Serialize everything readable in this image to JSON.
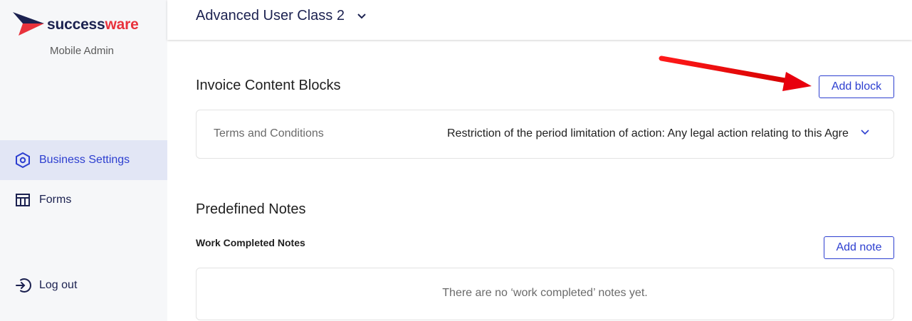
{
  "brand": {
    "name_part1": "success",
    "name_part2": "ware",
    "subtitle": "Mobile Admin",
    "colors": {
      "navy": "#1b2150",
      "red": "#e8323c",
      "blue": "#2d3fd0"
    }
  },
  "sidebar": {
    "items": [
      {
        "label": "Business Settings",
        "icon": "hexagon-settings-icon",
        "active": true
      },
      {
        "label": "Forms",
        "icon": "table-icon",
        "active": false
      }
    ],
    "logout": {
      "label": "Log out",
      "icon": "logout-icon"
    }
  },
  "header": {
    "title": "Advanced User Class 2",
    "icon": "chevron-down-icon"
  },
  "invoice": {
    "title": "Invoice Content Blocks",
    "add_button": "Add block",
    "blocks": [
      {
        "label": "Terms and Conditions",
        "value": "Restriction of the period limitation of action: Any legal action relating to this Agre"
      }
    ]
  },
  "notes": {
    "title": "Predefined Notes",
    "subtitle": "Work Completed Notes",
    "add_button": "Add note",
    "empty_text": "There are no ‘work completed’ notes yet."
  },
  "annotation": {
    "type": "red-arrow",
    "color": "#e8000d",
    "points_to": "Add block"
  }
}
